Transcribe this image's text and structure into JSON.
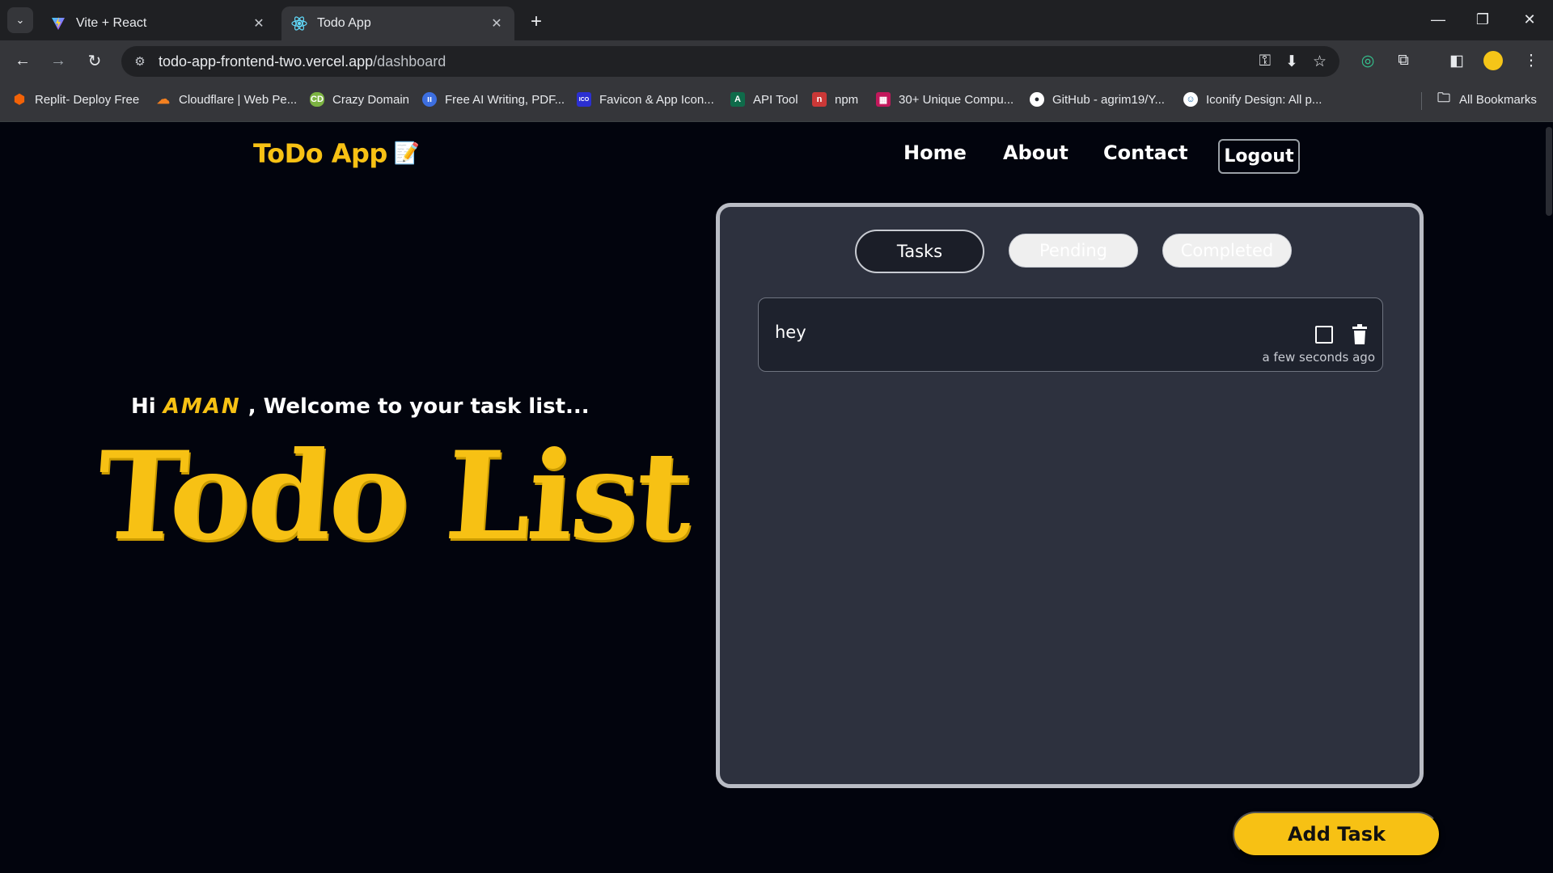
{
  "browser": {
    "tabs": [
      {
        "title": "Vite + React",
        "icon": "vite-icon",
        "active": false
      },
      {
        "title": "Todo App",
        "icon": "react-icon",
        "active": true
      }
    ],
    "url_host": "todo-app-frontend-two.vercel.app",
    "url_path": "/dashboard",
    "bookmarks": [
      {
        "label": "Replit- Deploy Free",
        "icon": "replit-icon",
        "color": "#f26207"
      },
      {
        "label": "Cloudflare | Web Pe...",
        "icon": "cloudflare-icon",
        "color": "#f38020"
      },
      {
        "label": "Crazy Domain",
        "icon": "crazydomain-icon",
        "color": "#7cb342"
      },
      {
        "label": "Free AI Writing, PDF...",
        "icon": "ai-writing-icon",
        "color": "#3d6fe0"
      },
      {
        "label": "Favicon & App Icon...",
        "icon": "favicon-icon",
        "color": "#2b2fd1"
      },
      {
        "label": "API Tool",
        "icon": "api-tool-icon",
        "color": "#0f6b4a"
      },
      {
        "label": "npm",
        "icon": "npm-icon",
        "color": "#cb3837"
      },
      {
        "label": "30+ Unique Compu...",
        "icon": "unique-icon",
        "color": "#c2185b"
      },
      {
        "label": "GitHub - agrim19/Y...",
        "icon": "github-icon",
        "color": "#ffffff"
      },
      {
        "label": "Iconify Design: All p...",
        "icon": "iconify-icon",
        "color": "#ffffff"
      }
    ],
    "all_bookmarks_label": "All Bookmarks"
  },
  "app": {
    "brand": "ToDo App",
    "brand_emoji": "📝",
    "nav": {
      "home": "Home",
      "about": "About",
      "contact": "Contact",
      "logout": "Logout"
    },
    "welcome_prefix": "Hi",
    "user_name": "AMAN",
    "welcome_suffix": ", Welcome to your task list...",
    "hero_title": "Todo List",
    "filters": {
      "tasks": "Tasks",
      "pending": "Pending",
      "completed": "Completed"
    },
    "active_filter": "Tasks",
    "tasks": [
      {
        "text": "hey",
        "time": "a few seconds ago",
        "completed": false
      }
    ],
    "add_task_label": "Add Task"
  },
  "colors": {
    "accent": "#f7c114",
    "background": "#02040d",
    "panel": "#2d313e"
  }
}
